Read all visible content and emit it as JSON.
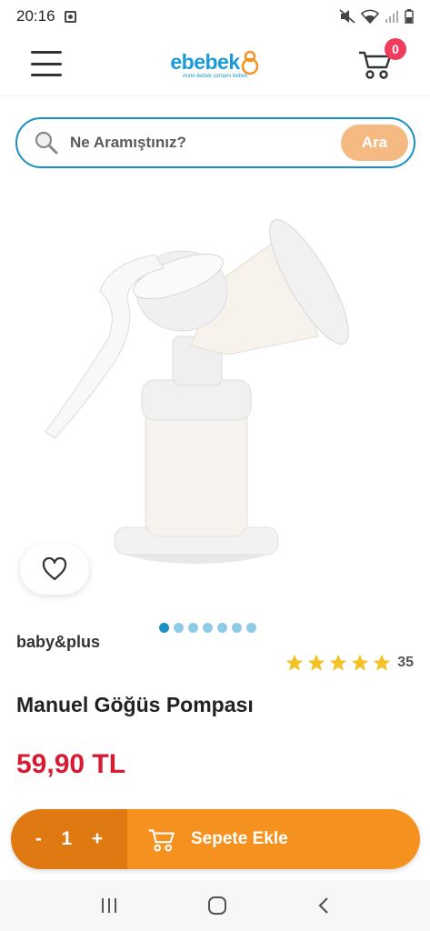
{
  "status_bar": {
    "time": "20:16"
  },
  "header": {
    "logo_text": "ebebek",
    "logo_tagline": "Anne-bebek uzmanı bebek",
    "cart_count": "0"
  },
  "search": {
    "placeholder": "Ne Aramıştınız?",
    "button_label": "Ara"
  },
  "product": {
    "brand": "baby&plus",
    "title": "Manuel Göğüs Pompası",
    "price": "59,90 TL",
    "rating_count": "35",
    "rating_stars": 5,
    "image_dots": 7,
    "active_dot": 0
  },
  "cart_bar": {
    "minus": "-",
    "quantity": "1",
    "plus": "+",
    "add_label": "Sepete Ekle"
  },
  "colors": {
    "brand_blue": "#1a8fc4",
    "price_red": "#d61b35",
    "cta_orange": "#f4911f",
    "cta_dark": "#de7a11"
  }
}
